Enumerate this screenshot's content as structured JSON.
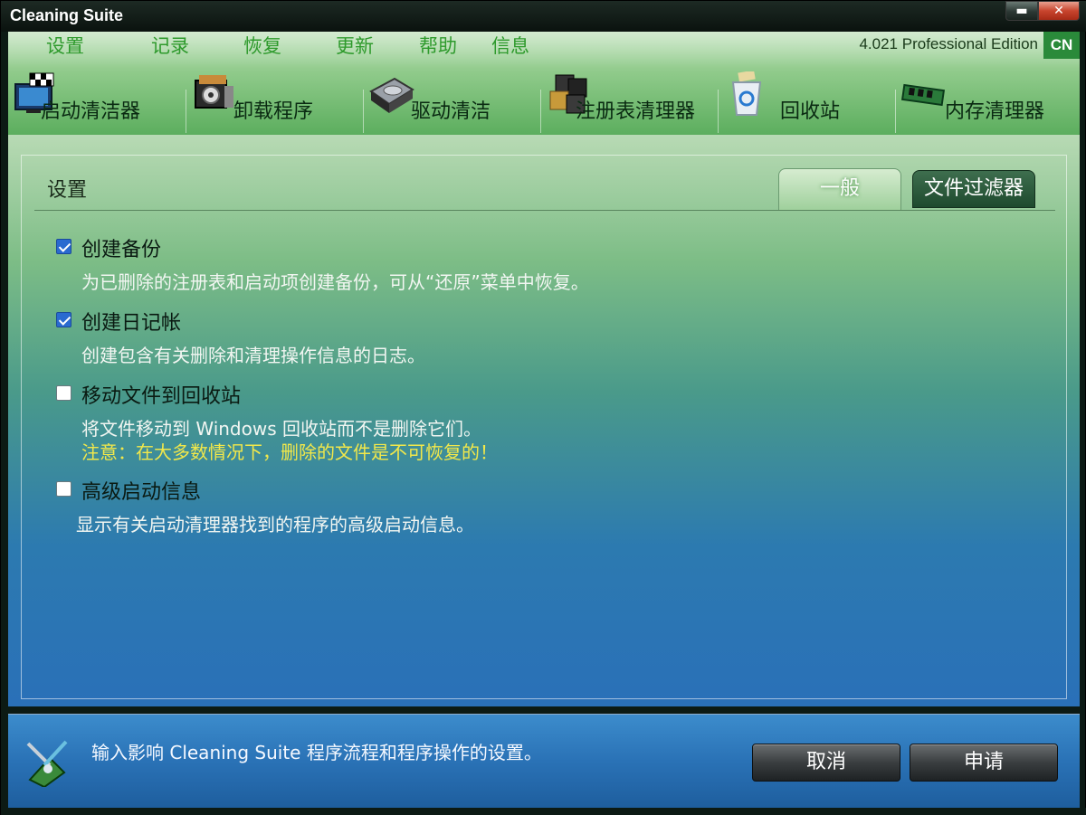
{
  "window": {
    "title": "Cleaning Suite",
    "minimize_label": "▬",
    "close_label": "✕"
  },
  "menu": {
    "items": [
      "设置",
      "记录",
      "恢复",
      "更新",
      "帮助",
      "信息"
    ],
    "edition": "4.021 Professional Edition",
    "lang": "CN"
  },
  "toolbar": {
    "items": [
      {
        "label": "启动清洁器",
        "icon": "startup-cleaner-icon"
      },
      {
        "label": "卸载程序",
        "icon": "uninstaller-icon"
      },
      {
        "label": "驱动清洁",
        "icon": "drive-cleaner-icon"
      },
      {
        "label": "注册表清理器",
        "icon": "registry-cleaner-icon"
      },
      {
        "label": "回收站",
        "icon": "recycle-bin-icon"
      },
      {
        "label": "内存清理器",
        "icon": "memory-cleaner-icon"
      }
    ]
  },
  "panel": {
    "title": "设置",
    "tabs": [
      {
        "label": "一般",
        "active": true
      },
      {
        "label": "文件过滤器",
        "active": false
      }
    ]
  },
  "options": [
    {
      "label": "创建备份",
      "checked": true,
      "desc": "为已删除的注册表和启动项创建备份，可从“还原”菜单中恢复。",
      "note": ""
    },
    {
      "label": "创建日记帐",
      "checked": true,
      "desc": "创建包含有关删除和清理操作信息的日志。",
      "note": ""
    },
    {
      "label": "移动文件到回收站",
      "checked": false,
      "desc": "将文件移动到 Windows 回收站而不是删除它们。",
      "note": "注意：在大多数情况下，删除的文件是不可恢复的！"
    },
    {
      "label": "高级启动信息",
      "checked": false,
      "desc": "显示有关启动清理器找到的程序的高级启动信息。",
      "note": ""
    }
  ],
  "footer": {
    "text": "输入影响 Cleaning Suite 程序流程和程序操作的设置。",
    "cancel_label": "取消",
    "apply_label": "申请"
  },
  "colors": {
    "menu_text": "#2e9a2c",
    "note_text": "#f2e84a",
    "checkbox_checked": "#2a6ad0",
    "lang_badge": "#2a8a3a"
  }
}
